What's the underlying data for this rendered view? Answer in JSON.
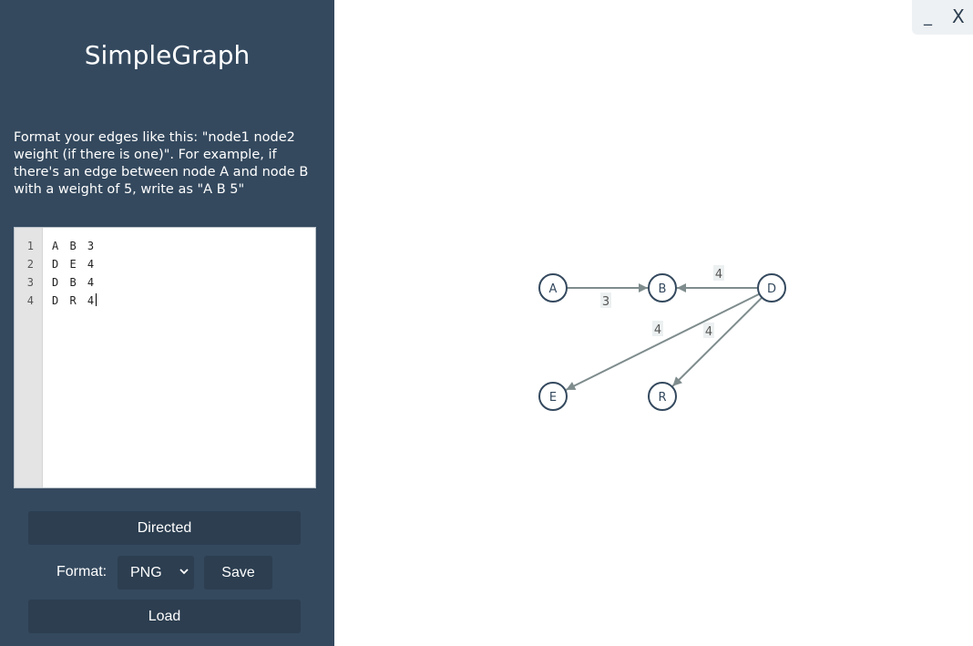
{
  "app": {
    "title": "SimpleGraph"
  },
  "window": {
    "minimize_label": "_",
    "close_label": "X"
  },
  "sidebar": {
    "instructions": "Format your edges like this: \"node1 node2 weight (if there is one)\". For example, if there's an edge between node A and node B with a weight of 5, write as \"A B 5\"",
    "editor": {
      "line_numbers": [
        "1",
        "2",
        "3",
        "4"
      ],
      "lines": [
        "A B 3",
        "D E 4",
        "D B 4",
        "D R 4"
      ]
    },
    "directed_label": "Directed",
    "format_label": "Format:",
    "format_selected": "PNG",
    "save_label": "Save",
    "load_label": "Load"
  },
  "graph": {
    "directed": true,
    "colors": {
      "node_stroke": "#34495e",
      "edge": "#7f8c8d",
      "label_bg": "#ecf0f1"
    },
    "nodes": [
      "A",
      "B",
      "D",
      "E",
      "R"
    ],
    "edges": [
      {
        "from": "A",
        "to": "B",
        "weight": "3"
      },
      {
        "from": "D",
        "to": "E",
        "weight": "4"
      },
      {
        "from": "D",
        "to": "B",
        "weight": "4"
      },
      {
        "from": "D",
        "to": "R",
        "weight": "4"
      }
    ]
  }
}
